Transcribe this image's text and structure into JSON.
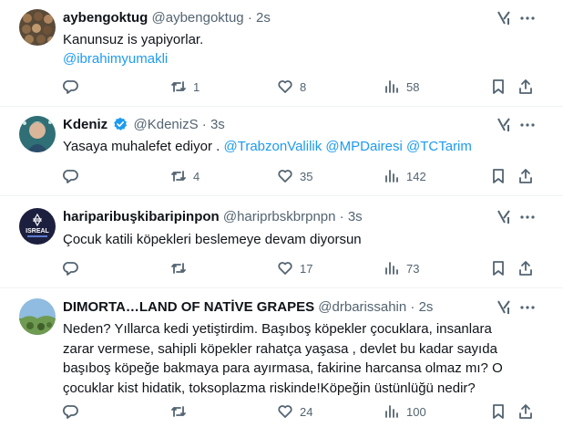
{
  "tweets": [
    {
      "name": "aybengoktug",
      "handle": "@aybengoktug",
      "time": "2s",
      "verified": false,
      "text": [
        "Kanunsuz is yapiyorlar."
      ],
      "mention_line": "@ibrahimyumakli",
      "replies": "",
      "retweets": "1",
      "likes": "8",
      "views": "58",
      "avatar_color": "#6b5a45"
    },
    {
      "name": "Kdeniz",
      "handle": "@KdenizS",
      "time": "3s",
      "verified": true,
      "text_prefix": "Yasaya muhalefet ediyor . ",
      "mentions": [
        "@TrabzonValilik",
        "@MPDairesi",
        "@TCTarim"
      ],
      "replies": "",
      "retweets": "4",
      "likes": "35",
      "views": "142",
      "avatar_color": "#3f8a8c"
    },
    {
      "name": "hariparibuşkibaripinpon",
      "handle": "@hariprbskbrpnpn",
      "time": "3s",
      "verified": false,
      "text": [
        "Çocuk katili köpekleri beslemeye devam diyorsun"
      ],
      "replies": "",
      "retweets": "",
      "likes": "17",
      "views": "73",
      "avatar_color": "#1c1f3d",
      "avatar_text": "ISREAL"
    },
    {
      "name": "DIMORTA…LAND OF NATİVE GRAPES",
      "handle": "@drbarissahin",
      "time": "2s",
      "verified": false,
      "text": [
        "Neden? Yıllarca kedi yetiştirdim. Başıboş köpekler çocuklara, insanlara",
        "zarar vermese, sahipli köpekler rahatça yaşasa , devlet bu kadar sayıda",
        "başıboş köpeğe bakmaya para ayırmasa, fakirine harcansa olmaz mı? O",
        "çocuklar kist hidatik, toksoplazma riskinde!Köpeğin üstünlüğü nedir?"
      ],
      "replies": "",
      "retweets": "",
      "likes": "24",
      "views": "100",
      "avatar_color": "#6f9a52"
    }
  ],
  "colors": {
    "link": "#1d9bf0",
    "muted": "#536471",
    "text": "#0f1419",
    "verified": "#1d9bf0"
  },
  "icons": [
    "reply-icon",
    "retweet-icon",
    "like-icon",
    "views-icon",
    "bookmark-icon",
    "share-icon",
    "grok-icon",
    "more-icon",
    "verified-badge-icon"
  ]
}
